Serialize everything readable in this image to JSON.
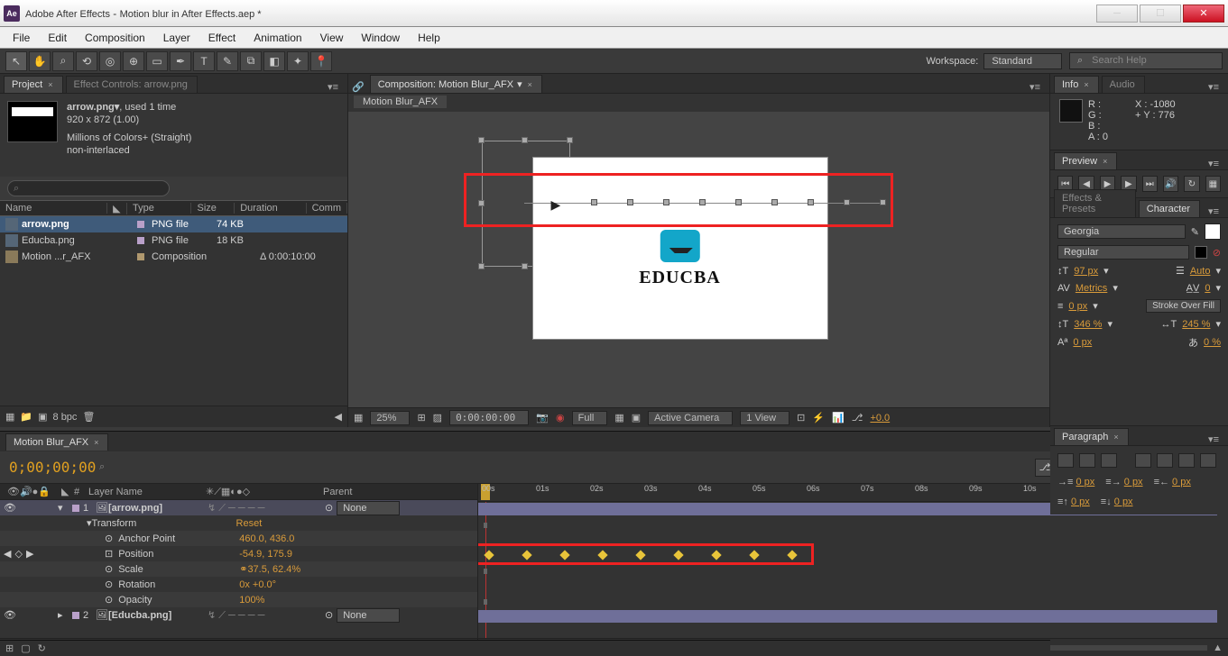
{
  "titlebar": {
    "app": "Adobe After Effects",
    "file": "Motion blur in After Effects.aep *"
  },
  "menu": [
    "File",
    "Edit",
    "Composition",
    "Layer",
    "Effect",
    "Animation",
    "View",
    "Window",
    "Help"
  ],
  "workspace": {
    "label": "Workspace:",
    "value": "Standard"
  },
  "searchHelp": "Search Help",
  "projectPanel": {
    "tab": "Project",
    "tab2": "Effect Controls: arrow.png",
    "asset": {
      "name": "arrow.png▾",
      "used": ", used 1 time",
      "dims": "920 x 872 (1.00)",
      "colors": "Millions of Colors+ (Straight)",
      "interlace": "non-interlaced"
    },
    "columns": {
      "name": "Name",
      "type": "Type",
      "size": "Size",
      "duration": "Duration",
      "comment": "Comm"
    },
    "rows": [
      {
        "name": "arrow.png",
        "type": "PNG file",
        "size": "74 KB",
        "duration": "",
        "selected": true
      },
      {
        "name": "Educba.png",
        "type": "PNG file",
        "size": "18 KB",
        "duration": ""
      },
      {
        "name": "Motion ...r_AFX",
        "type": "Composition",
        "size": "",
        "duration": "Δ 0:00:10:00"
      }
    ],
    "footer": {
      "bpc": "8 bpc"
    }
  },
  "compPanel": {
    "tab": "Composition: Motion Blur_AFX",
    "subtab": "Motion Blur_AFX",
    "logoWord": "EDUCBA",
    "footer": {
      "zoom": "25%",
      "time": "0:00:00:00",
      "quality": "Full",
      "camera": "Active Camera",
      "view": "1 View",
      "exposure": "+0.0"
    }
  },
  "infoPanel": {
    "tab": "Info",
    "tab2": "Audio",
    "R": "R :",
    "G": "G :",
    "B": "B :",
    "A": "A : 0",
    "X": "X : -1080",
    "Y": "Y : 776"
  },
  "previewPanel": {
    "tab": "Preview"
  },
  "charPanel": {
    "tab1": "Effects & Presets",
    "tab2": "Character",
    "font": "Georgia",
    "style": "Regular",
    "size": "97 px",
    "leading": "Auto",
    "kerning": "Metrics",
    "tracking": "0",
    "strokeW": "0 px",
    "strokeOpt": "Stroke Over Fill",
    "vscale": "346 %",
    "hscale": "245 %",
    "baseline": "0 px",
    "tsume": "0 %"
  },
  "paragraphPanel": {
    "tab": "Paragraph",
    "indentL": "0 px",
    "indentR": "0 px",
    "indentFirst": "0 px",
    "spaceBefore": "0 px",
    "spaceAfter": "0 px"
  },
  "timeline": {
    "tab": "Motion Blur_AFX",
    "time": "0;00;00;00",
    "cols": {
      "num": "#",
      "layerName": "Layer Name",
      "parent": "Parent"
    },
    "layers": [
      {
        "num": "1",
        "name": "[arrow.png]",
        "parent": "None",
        "selected": true
      },
      {
        "num": "2",
        "name": "[Educba.png]",
        "parent": "None"
      }
    ],
    "transform": {
      "label": "Transform",
      "reset": "Reset",
      "anchor": {
        "label": "Anchor Point",
        "val": "460.0, 436.0"
      },
      "position": {
        "label": "Position",
        "val": "-54.9, 175.9"
      },
      "scale": {
        "label": "Scale",
        "val": "37.5, 62.4%"
      },
      "rotation": {
        "label": "Rotation",
        "val": "0x +0.0°"
      },
      "opacity": {
        "label": "Opacity",
        "val": "100%"
      }
    },
    "ruler": [
      "00s",
      "01s",
      "02s",
      "03s",
      "04s",
      "05s",
      "06s",
      "07s",
      "08s",
      "09s",
      "10s"
    ],
    "toggleSwitches": "Toggle Switches / Modes"
  }
}
